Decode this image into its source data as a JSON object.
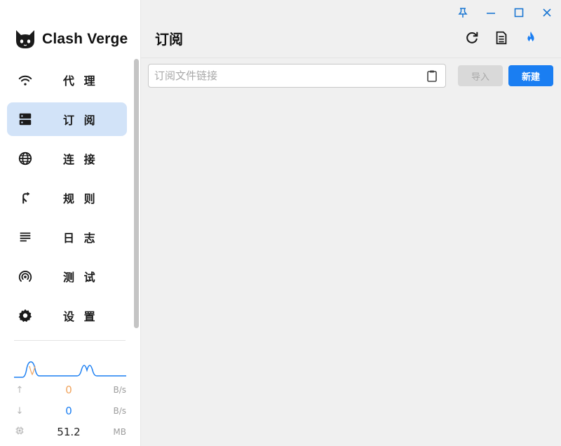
{
  "app": {
    "name": "Clash Verge",
    "logo_icon": "cat-icon"
  },
  "window_controls": [
    {
      "name": "pin",
      "icon": "pin-icon"
    },
    {
      "name": "minimize",
      "icon": "minimize-icon"
    },
    {
      "name": "maximize",
      "icon": "maximize-icon"
    },
    {
      "name": "close",
      "icon": "close-icon"
    }
  ],
  "sidebar": {
    "items": [
      {
        "label": "代 理",
        "icon": "wifi-icon",
        "active": false
      },
      {
        "label": "订 阅",
        "icon": "server-icon",
        "active": true
      },
      {
        "label": "连 接",
        "icon": "globe-icon",
        "active": false
      },
      {
        "label": "规 则",
        "icon": "fork-arrow-icon",
        "active": false
      },
      {
        "label": "日 志",
        "icon": "list-lines-icon",
        "active": false
      },
      {
        "label": "测 试",
        "icon": "broadcast-icon",
        "active": false
      },
      {
        "label": "设 置",
        "icon": "gear-icon",
        "active": false
      }
    ]
  },
  "traffic": {
    "upload": {
      "value": "0",
      "unit": "B/s",
      "icon": "arrow-up-icon",
      "color": "#f0a35c"
    },
    "download": {
      "value": "0",
      "unit": "B/s",
      "icon": "arrow-down-icon",
      "color": "#1a7ef2"
    },
    "memory": {
      "value": "51.2",
      "unit": "MB",
      "icon": "chip-icon",
      "color": "#222222"
    }
  },
  "page": {
    "title": "订阅",
    "actions": [
      {
        "name": "refresh",
        "icon": "refresh-icon"
      },
      {
        "name": "document",
        "icon": "document-icon"
      },
      {
        "name": "fire",
        "icon": "fire-icon"
      }
    ]
  },
  "subscription": {
    "input_placeholder": "订阅文件链接",
    "input_value": "",
    "paste_icon": "clipboard-icon",
    "import_label": "导入",
    "new_label": "新建"
  },
  "colors": {
    "accent": "#1a7ef2",
    "active_nav_bg": "#d2e3f8",
    "upload_graph": "#f0a35c",
    "download_graph": "#1a7ef2"
  }
}
